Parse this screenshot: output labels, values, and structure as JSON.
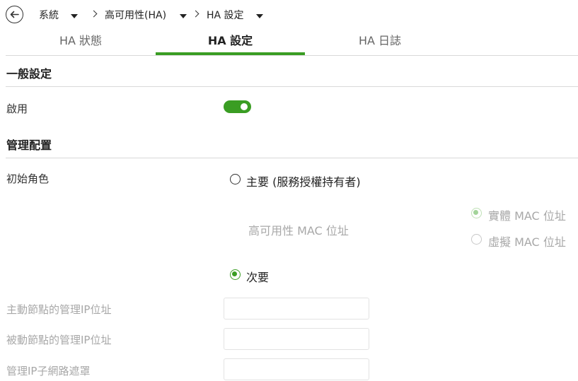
{
  "breadcrumb": {
    "system": "系統",
    "ha": "高可用性(HA)",
    "ha_settings": "HA 設定"
  },
  "tabs": [
    {
      "label": "HA 狀態",
      "active": false
    },
    {
      "label": "HA 設定",
      "active": true
    },
    {
      "label": "HA 日誌",
      "active": false
    }
  ],
  "general": {
    "title": "一般設定",
    "enable_label": "啟用",
    "enabled": true
  },
  "management": {
    "title": "管理配置",
    "initial_role_label": "初始角色",
    "primary_label": "主要 (服務授權持有者)",
    "primary_selected": false,
    "ha_mac_label": "高可用性 MAC 位址",
    "physical_mac_label": "實體 MAC 位址",
    "physical_mac_selected": true,
    "virtual_mac_label": "虛擬 MAC 位址",
    "virtual_mac_selected": false,
    "secondary_label": "次要",
    "secondary_selected": true,
    "primary_ip_label": "主動節點的管理IP位址",
    "primary_ip_value": "",
    "passive_ip_label": "被動節點的管理IP位址",
    "passive_ip_value": "",
    "subnet_label": "管理IP子網路遮罩",
    "subnet_value": ""
  },
  "colors": {
    "accent": "#3a9d23",
    "disabled_text": "#a8a8a8",
    "divider": "#d9d9d9"
  },
  "icons": {
    "back": "back-arrow-circle-icon",
    "dropdown": "caret-down-icon",
    "separator": "chevron-right-icon"
  }
}
